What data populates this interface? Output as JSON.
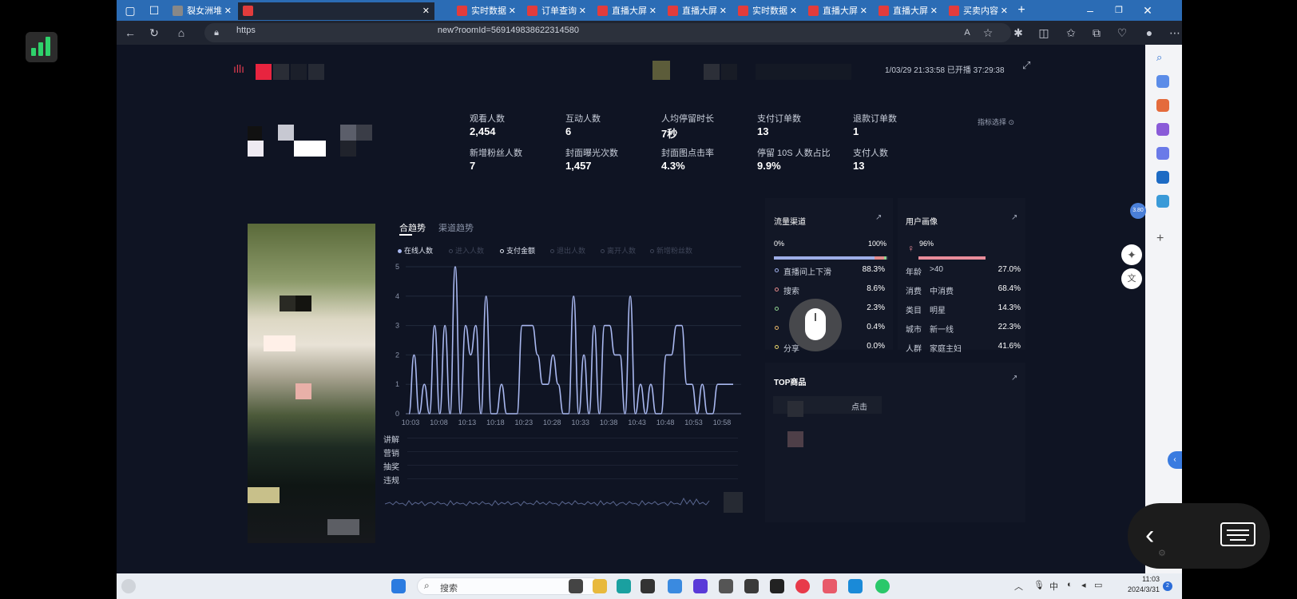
{
  "browser": {
    "tabs": [
      {
        "label": "",
        "favicon": "window-icon"
      },
      {
        "label": "",
        "favicon": "tab-list-icon"
      },
      {
        "label": "裂女洲堆",
        "favicon": "site-icon"
      },
      {
        "label": "",
        "favicon": "brand-icon"
      },
      {
        "label": "实时数据",
        "favicon": "brand-icon"
      },
      {
        "label": "订单查询",
        "favicon": "brand-icon"
      },
      {
        "label": "直播大屏",
        "favicon": "brand-icon"
      },
      {
        "label": "直播大屏",
        "favicon": "brand-icon"
      },
      {
        "label": "实时数据",
        "favicon": "brand-icon"
      },
      {
        "label": "直播大屏",
        "favicon": "brand-icon"
      },
      {
        "label": "直播大屏",
        "favicon": "brand-icon"
      },
      {
        "label": "买卖内容",
        "favicon": "brand-icon"
      }
    ],
    "url_prefix": "https",
    "url_suffix": "new?roomId=569149838622314580",
    "read_aloud_label": "A"
  },
  "header": {
    "datetime": "1/03/29 21:33:58 已开播 37:29:38"
  },
  "stats": {
    "metrics_select_label": "指标选择 ⊙",
    "row1": [
      {
        "label": "观看人数",
        "value": "2,454"
      },
      {
        "label": "互动人数",
        "value": "6"
      },
      {
        "label": "人均停留时长",
        "value": "7秒"
      },
      {
        "label": "支付订单数",
        "value": "13"
      },
      {
        "label": "退款订单数",
        "value": "1"
      }
    ],
    "row2": [
      {
        "label": "新增粉丝人数",
        "value": "7"
      },
      {
        "label": "封面曝光次数",
        "value": "1,457"
      },
      {
        "label": "封面图点击率",
        "value": "4.3%"
      },
      {
        "label": "停留 10S 人数占比",
        "value": "9.9%"
      },
      {
        "label": "支付人数",
        "value": "13"
      }
    ]
  },
  "trend": {
    "tabs": [
      "合趋势",
      "渠道趋势"
    ],
    "legend": [
      "在线人数",
      "进入人数",
      "支付金额",
      "退出人数",
      "离开人数",
      "新增粉丝数"
    ],
    "event_rows": [
      "讲解",
      "营销",
      "抽奖",
      "违规"
    ]
  },
  "chart_data": {
    "type": "line",
    "x": [
      "10:03",
      "10:08",
      "10:13",
      "10:18",
      "10:23",
      "10:28",
      "10:33",
      "10:38",
      "10:43",
      "10:48",
      "10:53",
      "10:58"
    ],
    "y_ticks": [
      0,
      1,
      2,
      3,
      4,
      5
    ],
    "ylim": [
      0,
      5
    ],
    "series": [
      {
        "name": "在线人数",
        "color": "#a9b8f0",
        "values": [
          0,
          2,
          0,
          1,
          0,
          3,
          0,
          3,
          0,
          5,
          0,
          3,
          2,
          3,
          0,
          4,
          0,
          0,
          1,
          0,
          0,
          0,
          3,
          3,
          3,
          2,
          1,
          1,
          2,
          1,
          0,
          0,
          4,
          0,
          2,
          0,
          3,
          0,
          3,
          3,
          2,
          2,
          0,
          4,
          0,
          1,
          0,
          1,
          0,
          0,
          2,
          2,
          3,
          3,
          1,
          1,
          0,
          1,
          0,
          0,
          1,
          1,
          1,
          1
        ]
      }
    ]
  },
  "traffic": {
    "title": "流量渠道",
    "bar_left": "0%",
    "bar_right": "100%",
    "rows": [
      {
        "label": "直播间上下滑",
        "value": "88.3%"
      },
      {
        "label": "搜索",
        "value": "8.6%"
      },
      {
        "label": "",
        "value": "2.3%"
      },
      {
        "label": "",
        "value": "0.4%"
      },
      {
        "label": "分享",
        "value": "0.0%"
      }
    ]
  },
  "audience": {
    "title": "用户画像",
    "female_pct": "96%",
    "rows": [
      {
        "label": "年龄",
        "value_label": ">40",
        "value": "27.0%"
      },
      {
        "label": "消费",
        "value_label": "中消费",
        "value": "68.4%"
      },
      {
        "label": "类目",
        "value_label": "明星",
        "value": "14.3%"
      },
      {
        "label": "城市",
        "value_label": "新一线",
        "value": "22.3%"
      },
      {
        "label": "人群",
        "value_label": "家庭主妇",
        "value": "41.6%"
      }
    ]
  },
  "top_products": {
    "title": "TOP商品",
    "col_label": "点击"
  },
  "sidebar_badge": "3.80",
  "taskbar": {
    "search_placeholder": "搜索",
    "ime_label": "中",
    "time": "11:03",
    "date": "2024/3/31",
    "notification_count": "2"
  },
  "colors": {
    "accent": "#2b6cb5",
    "dashboard_bg": "#0f1423",
    "line": "#a9b8f0",
    "female": "#e98c9a"
  }
}
